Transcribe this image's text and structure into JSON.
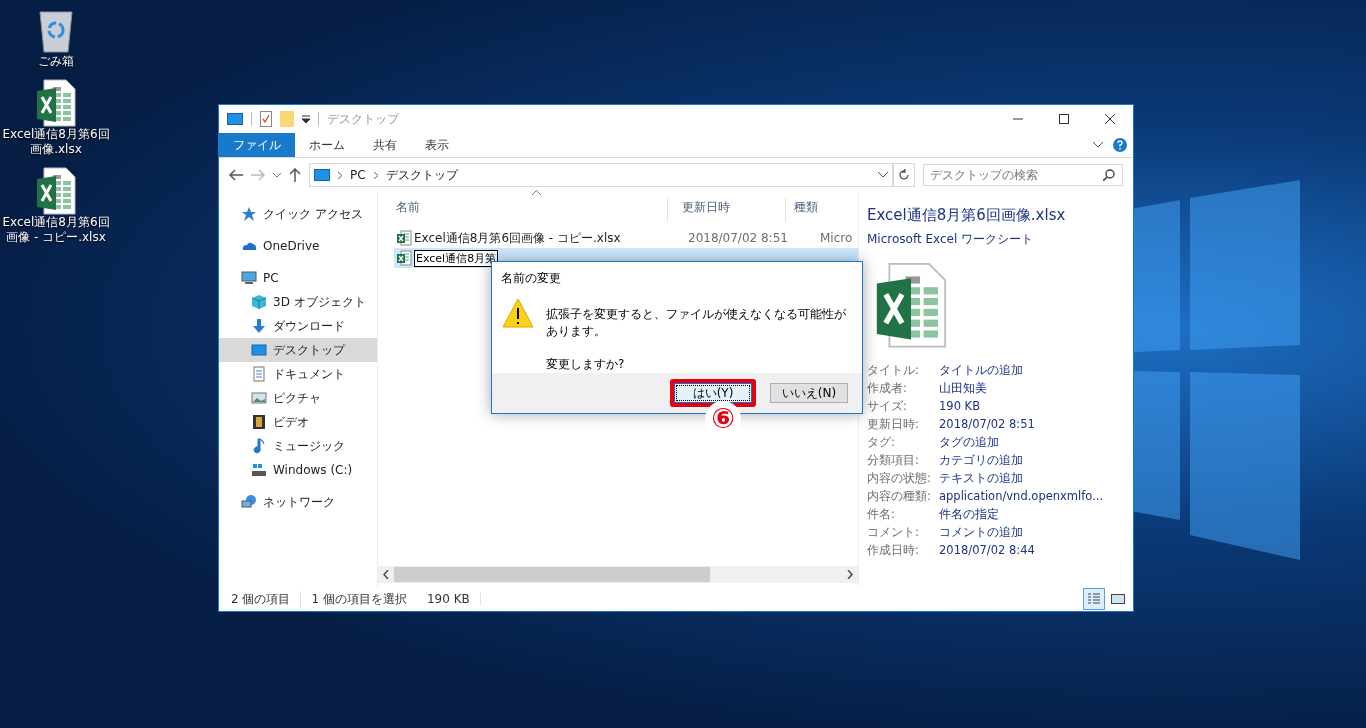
{
  "desktop": {
    "icons": [
      {
        "label": "ごみ箱",
        "kind": "recycle"
      },
      {
        "label": "Excel通信8月第6回画像.xlsx",
        "kind": "excel"
      },
      {
        "label": "Excel通信8月第6回画像 - コピー.xlsx",
        "kind": "excel"
      }
    ]
  },
  "window": {
    "title": "デスクトップ"
  },
  "ribbon": {
    "tabs": [
      {
        "label": "ファイル",
        "selected": true
      },
      {
        "label": "ホーム",
        "selected": false
      },
      {
        "label": "共有",
        "selected": false
      },
      {
        "label": "表示",
        "selected": false
      }
    ]
  },
  "address": {
    "path": [
      "PC",
      "デスクトップ"
    ]
  },
  "search": {
    "placeholder": "デスクトップの検索"
  },
  "nav": {
    "items": [
      {
        "label": "クイック アクセス",
        "kind": "star",
        "selected": false
      },
      {
        "label": "OneDrive",
        "kind": "cloud",
        "selected": false
      },
      {
        "label": "PC",
        "kind": "pc",
        "selected": false,
        "children": [
          {
            "label": "3D オブジェクト",
            "kind": "cube",
            "selected": false
          },
          {
            "label": "ダウンロード",
            "kind": "download",
            "selected": false
          },
          {
            "label": "デスクトップ",
            "kind": "desktop",
            "selected": true
          },
          {
            "label": "ドキュメント",
            "kind": "document",
            "selected": false
          },
          {
            "label": "ピクチャ",
            "kind": "picture",
            "selected": false
          },
          {
            "label": "ビデオ",
            "kind": "video",
            "selected": false
          },
          {
            "label": "ミュージック",
            "kind": "music",
            "selected": false
          },
          {
            "label": "Windows (C:)",
            "kind": "drive",
            "selected": false
          }
        ]
      },
      {
        "label": "ネットワーク",
        "kind": "network",
        "selected": false
      }
    ]
  },
  "files": {
    "columns": [
      "名前",
      "更新日時",
      "種類"
    ],
    "rows": [
      {
        "name": "Excel通信8月第6回画像 - コピー.xlsx",
        "modified": "2018/07/02 8:51",
        "type": "Micro",
        "selected": false,
        "editing": false
      },
      {
        "name": "Excel通信8月第",
        "selected": true,
        "editing": true
      }
    ]
  },
  "details": {
    "title": "Excel通信8月第6回画像.xlsx",
    "subtitle": "Microsoft Excel ワークシート",
    "properties": [
      {
        "label": "タイトル:",
        "value": "タイトルの追加"
      },
      {
        "label": "作成者:",
        "value": "山田知美"
      },
      {
        "label": "サイズ:",
        "value": "190 KB"
      },
      {
        "label": "更新日時:",
        "value": "2018/07/02 8:51"
      },
      {
        "label": "タグ:",
        "value": "タグの追加"
      },
      {
        "label": "分類項目:",
        "value": "カテゴリの追加"
      },
      {
        "label": "内容の状態:",
        "value": "テキストの追加"
      },
      {
        "label": "内容の種類:",
        "value": "application/vnd.openxmlfo..."
      },
      {
        "label": "件名:",
        "value": "件名の指定"
      },
      {
        "label": "コメント:",
        "value": "コメントの追加"
      },
      {
        "label": "作成日時:",
        "value": "2018/07/02 8:44"
      }
    ]
  },
  "status_bar": {
    "items": [
      "2 個の項目",
      "1 個の項目を選択",
      "190 KB"
    ],
    "views": [
      {
        "kind": "details",
        "selected": true
      },
      {
        "kind": "tiles",
        "selected": false
      }
    ]
  },
  "dialog": {
    "title": "名前の変更",
    "message": "拡張子を変更すると、ファイルが使えなくなる可能性があります。",
    "question": "変更しますか?",
    "buttons": [
      {
        "label": "はい(Y)",
        "default": true,
        "highlighted": true
      },
      {
        "label": "いいえ(N)",
        "default": false,
        "highlighted": false
      }
    ]
  },
  "annotation": {
    "label": "⑥"
  }
}
